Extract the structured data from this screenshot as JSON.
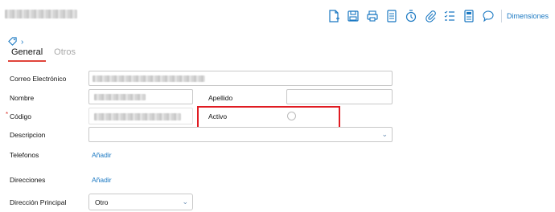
{
  "toolbar": {
    "icons": [
      "new-document-icon",
      "save-icon",
      "print-icon",
      "report-icon",
      "history-icon",
      "attachment-icon",
      "checklist-icon",
      "notes-icon",
      "comment-icon"
    ],
    "dimensions_label": "Dimensiones"
  },
  "tabs": [
    {
      "label": "General"
    },
    {
      "label": "Otros"
    }
  ],
  "form": {
    "email_label": "Correo Electrónico",
    "nombre_label": "Nombre",
    "apellido_label": "Apellido",
    "codigo_label": "Código",
    "activo_label": "Activo",
    "descripcion_label": "Descripcion",
    "telefonos_label": "Telefonos",
    "telefonos_add": "Añadir",
    "direcciones_label": "Direcciones",
    "direcciones_add": "Añadir",
    "direccion_principal_label": "Dirección Principal",
    "direccion_principal_value": "Otro"
  },
  "colors": {
    "accent": "#1a78c2",
    "tab_underline": "#e0443a",
    "highlight": "#e01b22"
  }
}
